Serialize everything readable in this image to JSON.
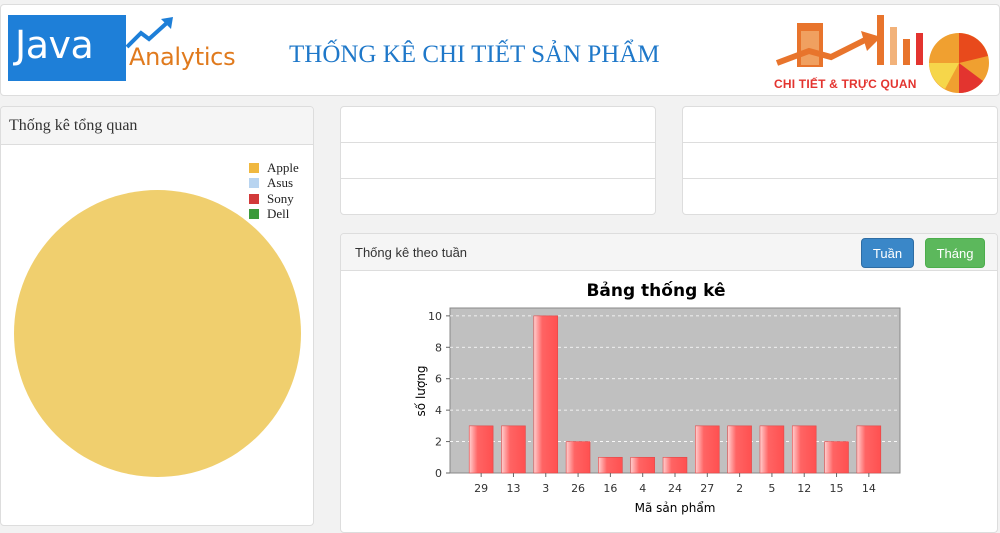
{
  "header": {
    "logo_java": "Java",
    "logo_analytics": "Analytics",
    "title": "THỐNG KÊ CHI TIẾT SẢN PHẨM",
    "brand_text": "CHI TIẾT & TRỰC QUAN"
  },
  "overview": {
    "title": "Thống kê tổng quan",
    "legend": [
      {
        "label": "Apple",
        "color": "#f0b840"
      },
      {
        "label": "Asus",
        "color": "#b8d4f0"
      },
      {
        "label": "Sony",
        "color": "#d23a3a"
      },
      {
        "label": "Dell",
        "color": "#3c9a3c"
      }
    ],
    "pie_color": "#f0cf6e"
  },
  "weekly": {
    "title": "Thống kê theo tuần",
    "btn_week": "Tuần",
    "btn_month": "Tháng"
  },
  "chart_data": {
    "type": "bar",
    "title": "Bảng thống kê",
    "xlabel": "Mã sản phẩm",
    "ylabel": "số lượng",
    "categories": [
      "29",
      "13",
      "3",
      "26",
      "16",
      "4",
      "24",
      "27",
      "2",
      "5",
      "12",
      "15",
      "14"
    ],
    "values": [
      3,
      3,
      10,
      2,
      1,
      1,
      1,
      3,
      3,
      3,
      3,
      2,
      3
    ],
    "ylim": [
      0,
      10.5
    ],
    "yticks": [
      0,
      2,
      4,
      6,
      8,
      10
    ],
    "grid": true,
    "bar_color": "#ff5f5f",
    "plot_bg": "#c0c0c0"
  }
}
